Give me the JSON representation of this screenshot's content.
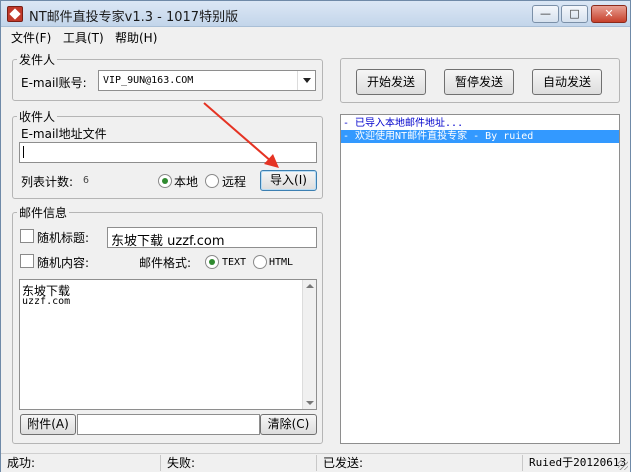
{
  "window": {
    "title": "NT邮件直投专家v1.3 - 1017特别版",
    "minimize_glyph": "—",
    "maximize_glyph": "□",
    "close_glyph": "✕"
  },
  "menu": [
    "文件(F)",
    "工具(T)",
    "帮助(H)"
  ],
  "sender": {
    "legend": "发件人",
    "account_label": "E-mail账号:",
    "account_value": "VIP_9UN@163.COM"
  },
  "receiver": {
    "legend": "收件人",
    "file_label": "E-mail地址文件",
    "file_value": "",
    "count_label": "列表计数:",
    "count_value": "6",
    "source_local": "本地",
    "source_remote": "远程",
    "source_selected": "local",
    "import_button": "导入(I)"
  },
  "mail": {
    "legend": "邮件信息",
    "random_subject_label": "随机标题:",
    "random_subject_checked": false,
    "subject_value": "东坡下载  uzzf.com",
    "random_content_label": "随机内容:",
    "random_content_checked": false,
    "format_label": "邮件格式:",
    "format_text": "TEXT",
    "format_html": "HTML",
    "format_selected": "TEXT",
    "body_line1": "东坡下载",
    "body_line2": "uzzf.com",
    "attach_button": "附件(A)",
    "attach_value": "",
    "clear_button": "清除(C)"
  },
  "actions": {
    "start": "开始发送",
    "pause": "暂停发送",
    "auto": "自动发送"
  },
  "log": [
    {
      "text": "- 已导入本地邮件地址...",
      "selected": false
    },
    {
      "text": "- 欢迎使用NT邮件直投专家 - By ruied",
      "selected": true
    }
  ],
  "status": {
    "success": "成功:",
    "fail": "失败:",
    "sent": "已发送:",
    "credit": "Ruied于20120613"
  },
  "colors": {
    "log_text": "#0000cc",
    "selection": "#3399ff",
    "arrow": "#e53323"
  }
}
